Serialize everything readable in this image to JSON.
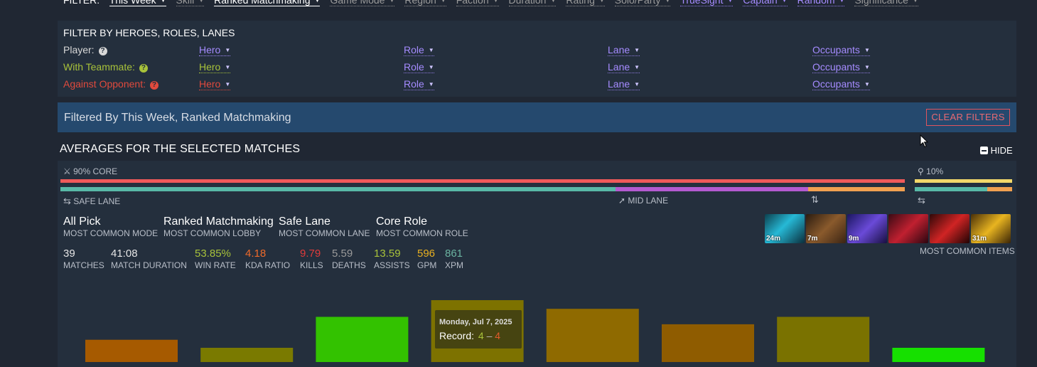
{
  "top_filter": {
    "label": "FILTER:",
    "items": [
      {
        "label": "This Week",
        "state": "selected"
      },
      {
        "label": "Skill",
        "state": "normal"
      },
      {
        "label": "Ranked Matchmaking",
        "state": "selected"
      },
      {
        "label": "Game Mode",
        "state": "normal"
      },
      {
        "label": "Region",
        "state": "normal"
      },
      {
        "label": "Faction",
        "state": "normal"
      },
      {
        "label": "Duration",
        "state": "normal"
      },
      {
        "label": "Rating",
        "state": "normal"
      },
      {
        "label": "Solo/Party",
        "state": "normal"
      },
      {
        "label": "TrueSight",
        "state": "purple"
      },
      {
        "label": "Captain",
        "state": "purple"
      },
      {
        "label": "Random",
        "state": "purple"
      },
      {
        "label": "Significance",
        "state": "normal"
      }
    ]
  },
  "hero_filter": {
    "title": "FILTER BY HEROES, ROLES, LANES",
    "rows": [
      {
        "label": "Player:",
        "color": "#d8d8d8",
        "hero": "Hero",
        "role": "Role",
        "lane": "Lane",
        "occupants": "Occupants"
      },
      {
        "label": "With Teammate:",
        "color": "#a8c23a",
        "hero": "Hero",
        "role": "Role",
        "lane": "Lane",
        "occupants": "Occupants"
      },
      {
        "label": "Against Opponent:",
        "color": "#e04a3d",
        "hero": "Hero",
        "role": "Role",
        "lane": "Lane",
        "occupants": "Occupants"
      }
    ]
  },
  "filtered_bar": {
    "text": "Filtered By This Week, Ranked Matchmaking",
    "clear_label": "CLEAR FILTERS"
  },
  "averages": {
    "title": "AVERAGES FOR THE SELECTED MATCHES",
    "hide_label": "HIDE",
    "core_label": "90% CORE",
    "support_label": "10%",
    "core_fraction": 0.9,
    "lanes": {
      "safe": "SAFE LANE",
      "mid": "MID LANE"
    },
    "most_common": [
      {
        "value": "All Pick",
        "label": "MOST COMMON MODE"
      },
      {
        "value": "Ranked Matchmaking",
        "label": "MOST COMMON LOBBY"
      },
      {
        "value": "Safe Lane",
        "label": "MOST COMMON LANE"
      },
      {
        "value": "Core Role",
        "label": "MOST COMMON ROLE"
      }
    ],
    "stats": [
      {
        "value": "39",
        "label": "MATCHES",
        "color": "#e6e6e6"
      },
      {
        "value": "41:08",
        "label": "MATCH DURATION",
        "color": "#e6e6e6"
      },
      {
        "value": "53.85%",
        "label": "WIN RATE",
        "color": "#a8c23a"
      },
      {
        "value": "4.18",
        "label": "KDA RATIO",
        "color": "#ef6a2a"
      },
      {
        "value": "9.79",
        "label": "KILLS",
        "color": "#e03b3b"
      },
      {
        "value": "5.59",
        "label": "DEATHS",
        "color": "#9a9a9a"
      },
      {
        "value": "13.59",
        "label": "ASSISTS",
        "color": "#a8c23a"
      },
      {
        "value": "596",
        "label": "GPM",
        "color": "#e8b020"
      },
      {
        "value": "861",
        "label": "XPM",
        "color": "#6bb3a0"
      }
    ],
    "items": [
      {
        "time": "24m",
        "name": "aghanims-icon"
      },
      {
        "time": "7m",
        "name": "boots-icon"
      },
      {
        "time": "9m",
        "name": "arcane-item-icon"
      },
      {
        "time": "",
        "name": "hammer-item-icon"
      },
      {
        "time": "",
        "name": "claw-item-icon"
      },
      {
        "time": "31m",
        "name": "gold-item-icon"
      }
    ],
    "items_label": "MOST COMMON ITEMS"
  },
  "tooltip": {
    "date": "Monday, Jul 7, 2025",
    "record_label": "Record:",
    "wins": "4",
    "sep": "–",
    "losses": "4"
  },
  "chart_data": {
    "type": "bar",
    "bars": [
      {
        "relative_height": 0.36,
        "color": "#a65a00"
      },
      {
        "relative_height": 0.23,
        "color": "#7a7a00"
      },
      {
        "relative_height": 0.73,
        "color": "#33c200"
      },
      {
        "relative_height": 1.0,
        "color": "#7d7200"
      },
      {
        "relative_height": 0.86,
        "color": "#8f6a00"
      },
      {
        "relative_height": 0.61,
        "color": "#8f5c00"
      },
      {
        "relative_height": 0.73,
        "color": "#7a7200"
      },
      {
        "relative_height": 0.23,
        "color": "#16e000"
      }
    ]
  }
}
